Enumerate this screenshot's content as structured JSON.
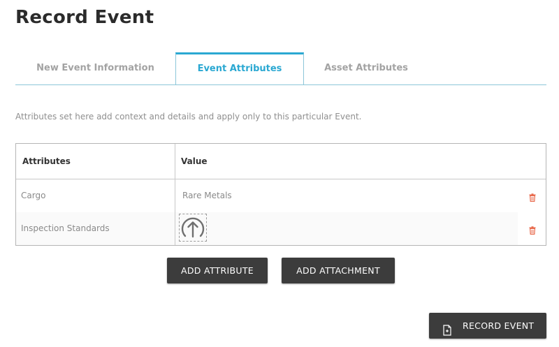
{
  "page": {
    "title": "Record Event"
  },
  "tabs": [
    {
      "label": "New Event Information",
      "active": false
    },
    {
      "label": "Event Attributes",
      "active": true
    },
    {
      "label": "Asset Attributes",
      "active": false
    }
  ],
  "description": "Attributes set here add context and details and apply only to this particular Event.",
  "table": {
    "headers": {
      "attribute": "Attributes",
      "value": "Value"
    },
    "rows": [
      {
        "attribute": "Cargo",
        "value": "Rare Metals",
        "value_type": "text",
        "action_icon": "trash-icon"
      },
      {
        "attribute": "Inspection Standards",
        "value": "",
        "value_type": "upload",
        "value_icon": "upload-arrow-icon",
        "action_icon": "trash-icon"
      }
    ]
  },
  "buttons": {
    "add_attribute": "ADD ATTRIBUTE",
    "add_attachment": "ADD ATTACHMENT",
    "record_event": "RECORD EVENT",
    "record_event_icon": "document-add-icon"
  },
  "colors": {
    "accent": "#2aa8d2",
    "tab_border": "#8cc6d9",
    "button_bg": "#3c3c3c",
    "delete": "#e8684a"
  }
}
